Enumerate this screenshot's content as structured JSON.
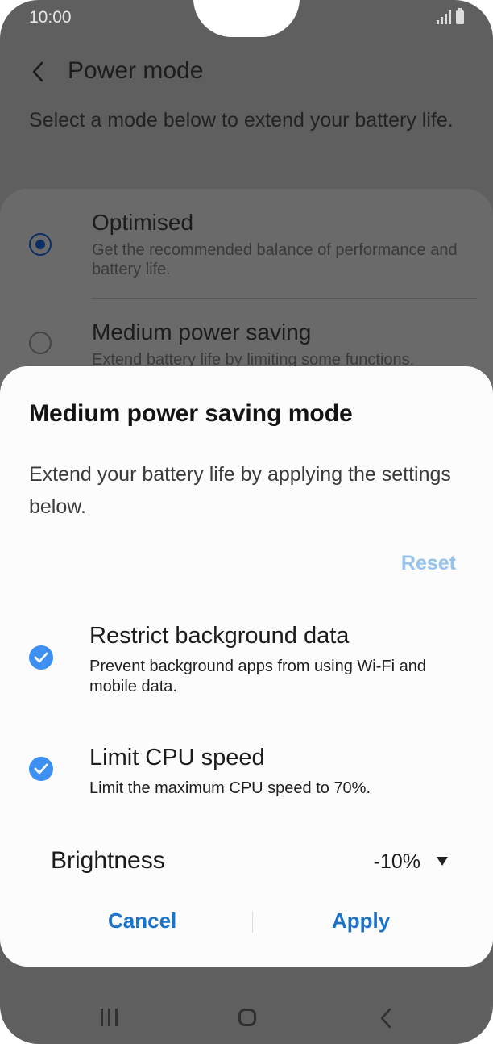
{
  "status_bar": {
    "time": "10:00"
  },
  "header": {
    "title": "Power mode"
  },
  "page": {
    "subtitle": "Select a mode below to extend your battery life."
  },
  "modes": [
    {
      "title": "Optimised",
      "description": "Get the recommended balance of performance and battery life.",
      "selected": true
    },
    {
      "title": "Medium power saving",
      "description": "Extend battery life by limiting some functions.",
      "selected": false
    }
  ],
  "dialog": {
    "title": "Medium power saving mode",
    "description": "Extend your battery life by applying the settings below.",
    "reset_label": "Reset",
    "options": [
      {
        "title": "Restrict background data",
        "description": "Prevent background apps from using Wi-Fi and mobile data.",
        "checked": true
      },
      {
        "title": "Limit CPU speed",
        "description": "Limit the maximum CPU speed to 70%.",
        "checked": true
      }
    ],
    "brightness": {
      "label": "Brightness",
      "value": "-10%"
    },
    "cancel_label": "Cancel",
    "apply_label": "Apply"
  },
  "colors": {
    "accent": "#1a73c9",
    "check": "#3d8ff2",
    "reset": "#96c2eb",
    "scrim": "#5f5f5f",
    "sheet": "#fcfcfc"
  },
  "icons": {
    "back": "chevron-left-icon",
    "check": "checkmark-icon",
    "dropdown": "caret-down-icon",
    "nav_recent": "recent-apps-icon",
    "nav_home": "home-icon",
    "nav_back": "back-icon"
  }
}
